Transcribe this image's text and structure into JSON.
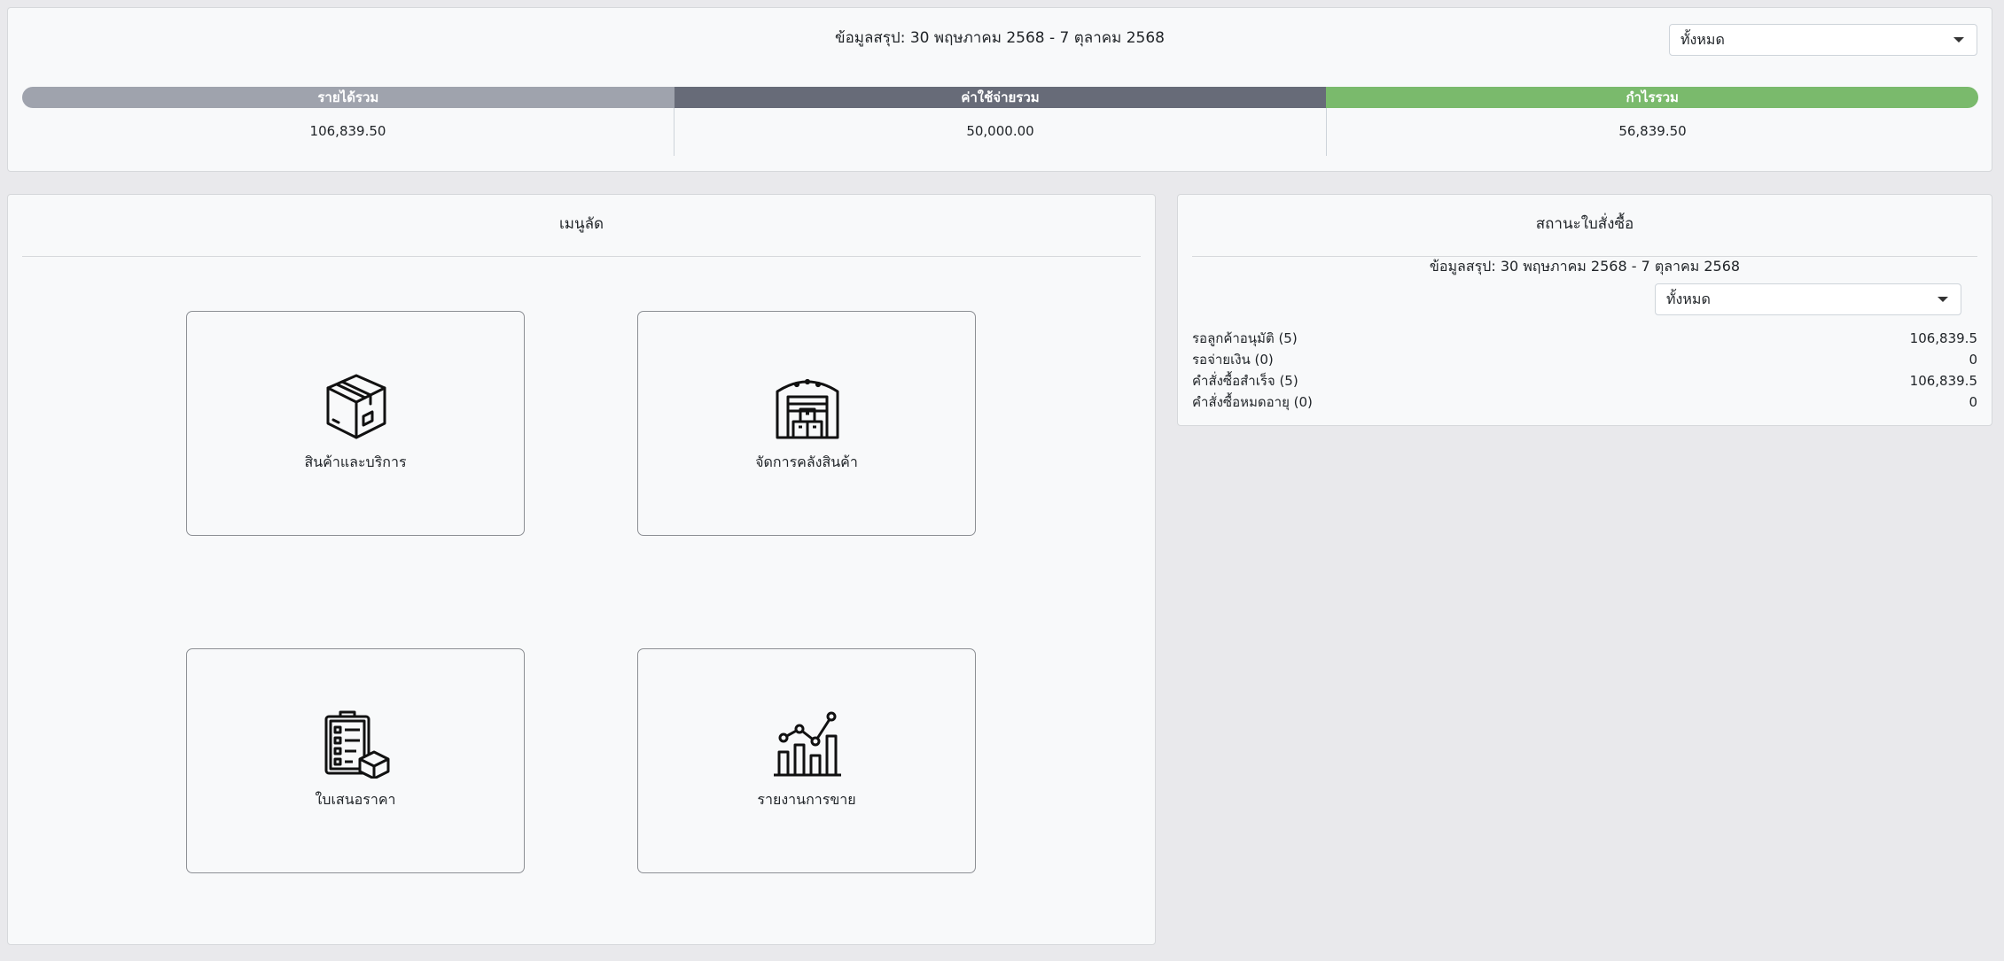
{
  "summary": {
    "period_text": "ข้อมูลสรุป: 30 พฤษภาคม 2568 - 7 ตุลาคม 2568",
    "filter_value": "ทั้งหมด",
    "headers": {
      "revenue": "รายได้รวม",
      "expense": "ค่าใช้จ่ายรวม",
      "profit": "กำไรรวม"
    },
    "values": {
      "revenue": "106,839.50",
      "expense": "50,000.00",
      "profit": "56,839.50"
    },
    "colors": {
      "revenue": "#9fa3ad",
      "expense": "#676b78",
      "profit": "#7aba6c"
    }
  },
  "menu": {
    "title": "เมนูลัด",
    "tiles": [
      {
        "label": "สินค้าและบริการ",
        "icon": "box-icon"
      },
      {
        "label": "จัดการคลังสินค้า",
        "icon": "warehouse-icon"
      },
      {
        "label": "ใบเสนอราคา",
        "icon": "clipboard-box-icon"
      },
      {
        "label": "รายงานการขาย",
        "icon": "chart-icon"
      }
    ]
  },
  "order_status": {
    "title": "สถานะใบสั่งซื้อ",
    "period_text": "ข้อมูลสรุป: 30 พฤษภาคม 2568 - 7 ตุลาคม 2568",
    "filter_value": "ทั้งหมด",
    "rows": [
      {
        "label": "รอลูกค้าอนุมัติ (5)",
        "value": "106,839.5"
      },
      {
        "label": "รอจ่ายเงิน (0)",
        "value": "0"
      },
      {
        "label": "คำสั่งซื้อสำเร็จ (5)",
        "value": "106,839.5"
      },
      {
        "label": "คำสั่งซื้อหมดอายุ (0)",
        "value": "0"
      }
    ]
  }
}
